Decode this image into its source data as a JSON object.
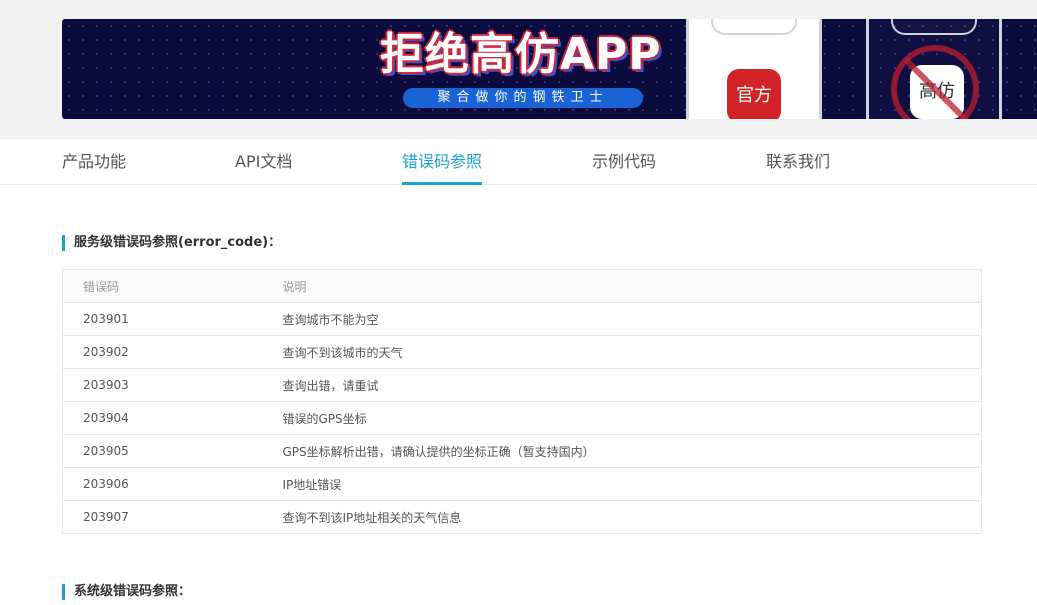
{
  "banner": {
    "title": "拒绝高仿APP",
    "subtitle": "聚合做你的钢铁卫士",
    "official_icon_label": "官方",
    "fake_icon_label": "高仿"
  },
  "nav": {
    "items": [
      {
        "label": "产品功能",
        "active": false
      },
      {
        "label": "API文档",
        "active": false
      },
      {
        "label": "错误码参照",
        "active": true
      },
      {
        "label": "示例代码",
        "active": false
      },
      {
        "label": "联系我们",
        "active": false
      }
    ]
  },
  "service_errors": {
    "title": "服务级错误码参照(error_code)：",
    "headers": {
      "code": "错误码",
      "desc": "说明"
    },
    "rows": [
      {
        "code": "203901",
        "desc": "查询城市不能为空"
      },
      {
        "code": "203902",
        "desc": "查询不到该城市的天气"
      },
      {
        "code": "203903",
        "desc": "查询出错，请重试"
      },
      {
        "code": "203904",
        "desc": "错误的GPS坐标"
      },
      {
        "code": "203905",
        "desc": "GPS坐标解析出错，请确认提供的坐标正确（暂支持国内）"
      },
      {
        "code": "203906",
        "desc": "IP地址错误"
      },
      {
        "code": "203907",
        "desc": "查询不到该IP地址相关的天气信息"
      }
    ]
  },
  "system_errors": {
    "title": "系统级错误码参照："
  },
  "colors": {
    "accent": "#1aa3d9",
    "banner_bg": "#0c0b3e",
    "official_red": "#d2232a"
  }
}
